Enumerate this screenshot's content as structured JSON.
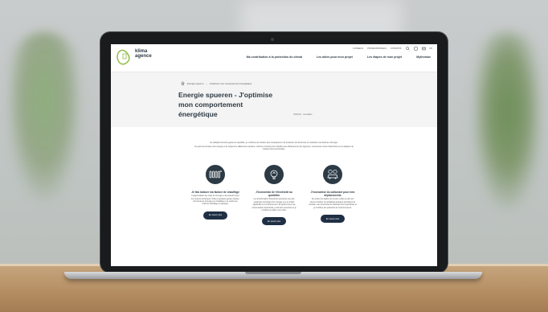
{
  "site": {
    "logo_line1": "klima",
    "logo_line2": "agence",
    "utility": [
      "CONSEILS",
      "PROFESSIONNELS",
      "À PROPOS",
      "FR"
    ],
    "nav": [
      "Ma contribution à la protection du climat",
      "Les aides pour mon projet",
      "Les étapes de mon projet",
      "Mythomax"
    ],
    "breadcrumb": [
      "Energie spueren",
      "J'optimise mon comportement énergétique"
    ],
    "hero_title": "Energie spueren - J'optimise mon comportement énergétique",
    "hero_meta": "02/02/22 · Actualités",
    "intro": [
      "En adoptant de bons gestes au quotidien, je contribue de manière plus conséquente à la protection du climat tout en réduisant mes factures d'énergie.",
      "Ce petit économiseur de l'énergie et de l'argent de différentes manières. Voici les conseils pour chauffer plus efficacement mon logement, consommer moins d'électricité et me déplacer de manière plus économique."
    ],
    "cards": [
      {
        "title": "Je fais baisser ma facture de chauffage",
        "body": "L'augmentation des coûts de l'énergie et la protection pour les mesures techniques. Grâce à quelques gestes simples, l'économie de l'énergie a le chauffage et se réduire les coûts de chauffage en quelques.",
        "button": "En savoir plus",
        "icon": "radiator-icon"
      },
      {
        "title": "J'économise de l'électricité au quotidien",
        "body": "La consommation d'électricité représente une part importante du budget d'un ménage et a un impact significatif sur l'environnement. En gérant mieux ma consommation d'électricité, je fais des économies et je contribue à réduire mes coûts.",
        "button": "En savoir plus",
        "icon": "lightbulb-icon"
      },
      {
        "title": "J'économise du carburant pour mes déplacements",
        "body": "Se rendre à la station de service et faire le plein est devenu coûteux. En pratiquant quelques techniques de conduite, mes économies de carburant sont importantes et je contribue à la protection de l'environnement.",
        "button": "En savoir plus",
        "icon": "car-icon"
      }
    ]
  }
}
